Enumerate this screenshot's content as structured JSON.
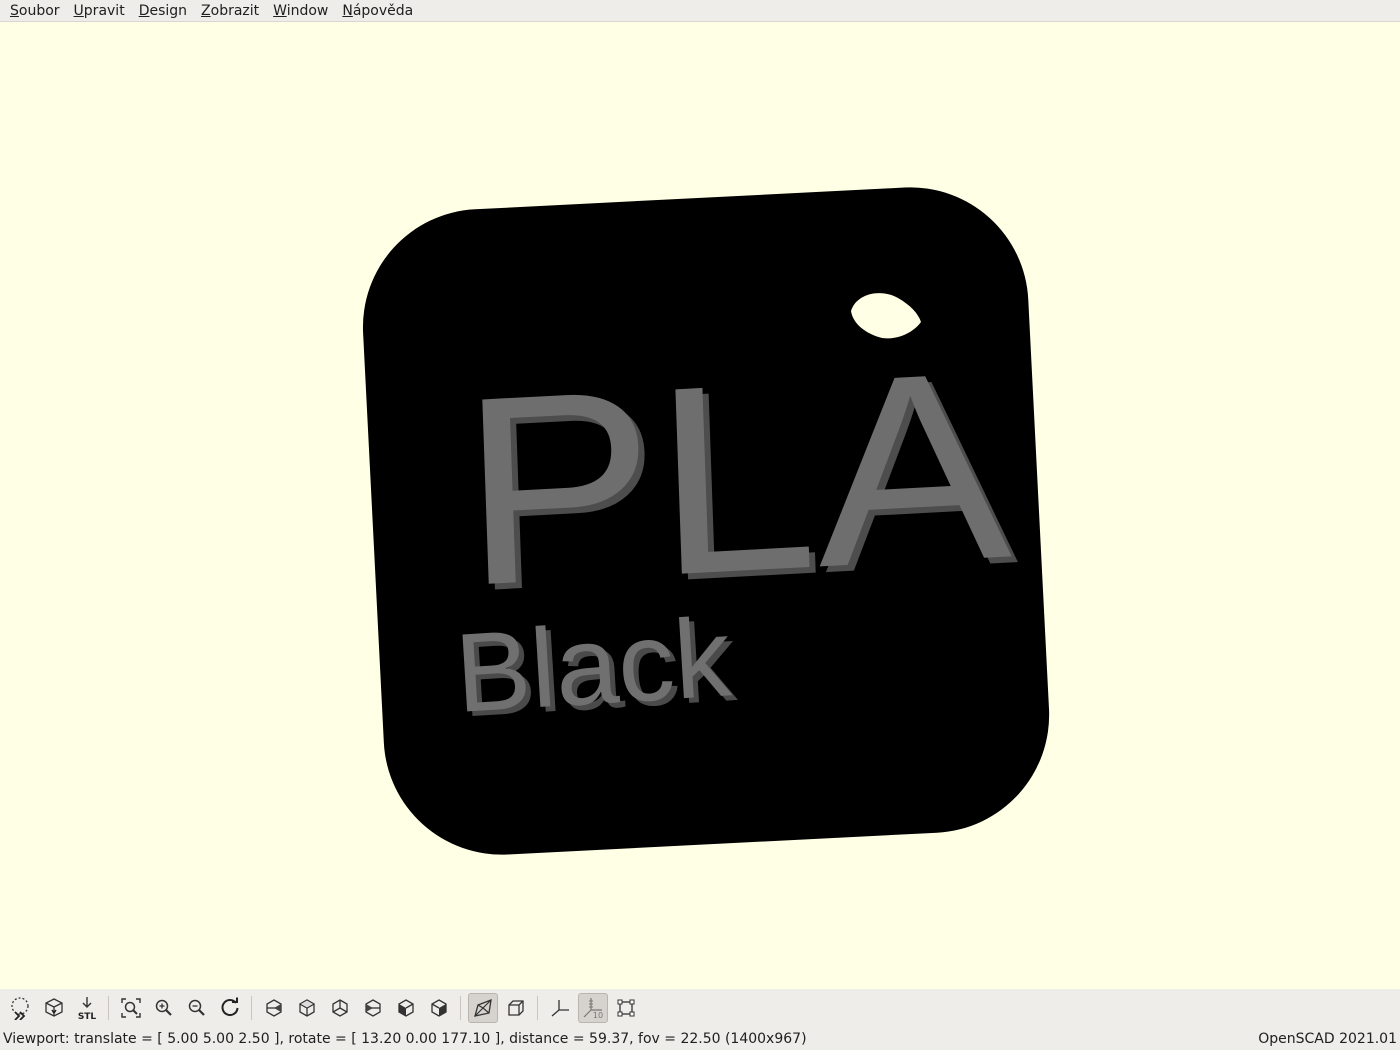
{
  "menu": {
    "file": {
      "mnemonic": "S",
      "rest": "oubor"
    },
    "edit": {
      "mnemonic": "U",
      "rest": "pravit"
    },
    "design": {
      "mnemonic": "D",
      "rest": "esign"
    },
    "view": {
      "mnemonic": "Z",
      "rest": "obrazit"
    },
    "window": {
      "mnemonic": "W",
      "rest": "indow"
    },
    "help": {
      "mnemonic": "N",
      "rest": "ápověda"
    }
  },
  "model": {
    "tag_text": "PLA",
    "subtext": "Black",
    "plate_color": "#000000",
    "text_color": "#6e6e6e",
    "background_color": "#ffffe5"
  },
  "toolbar": {
    "icons": [
      "preview-icon",
      "render-icon",
      "export-stl-icon",
      "view-all-icon",
      "zoom-in-icon",
      "zoom-out-icon",
      "reset-view-icon",
      "view-right-icon",
      "view-top-icon",
      "view-bottom-icon",
      "view-left-icon",
      "view-front-icon",
      "view-back-icon",
      "perspective-icon",
      "orthogonal-icon",
      "show-axes-icon",
      "show-scale-markers-icon",
      "show-edges-icon"
    ],
    "stl_label": "STL",
    "scale_label": "10"
  },
  "status": {
    "viewport": "Viewport: translate = [ 5.00 5.00 2.50 ], rotate = [ 13.20 0.00 177.10 ], distance = 59.37, fov = 22.50 (1400x967)",
    "version": "OpenSCAD 2021.01"
  }
}
